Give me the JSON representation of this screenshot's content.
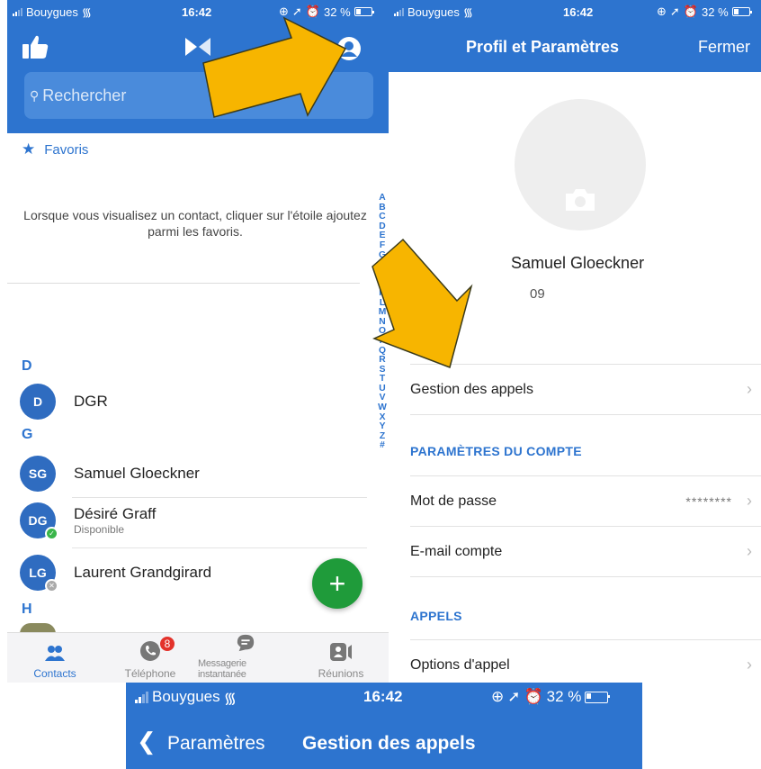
{
  "status_left": {
    "carrier": "Bouygues",
    "time": "16:42",
    "battery": "32 %"
  },
  "status_right": {
    "carrier": "Bouygues",
    "time": "16:42",
    "battery": "32 %"
  },
  "status_bottom": {
    "carrier": "Bouygues",
    "time": "16:42",
    "battery": "32 %"
  },
  "left": {
    "search_placeholder": "Rechercher",
    "favorites_label": "Favoris",
    "favorites_hint": "Lorsque vous visualisez un contact, cliquer sur l'étoile ajoutez parmi les favoris.",
    "index": [
      "A",
      "B",
      "C",
      "D",
      "E",
      "F",
      "G",
      "H",
      "I",
      "J",
      "K",
      "L",
      "M",
      "N",
      "O",
      "P",
      "Q",
      "R",
      "S",
      "T",
      "U",
      "V",
      "W",
      "X",
      "Y",
      "Z",
      "#"
    ],
    "sections": {
      "d": "D",
      "g": "G",
      "h": "H"
    },
    "contacts": [
      {
        "initials": "D",
        "name": "DGR",
        "status": ""
      },
      {
        "initials": "SG",
        "name": "Samuel Gloeckner",
        "status": ""
      },
      {
        "initials": "DG",
        "name": "Désiré Graff",
        "status": "Disponible"
      },
      {
        "initials": "LG",
        "name": "Laurent Grandgirard",
        "status": ""
      }
    ],
    "fab_label": "+",
    "tabs": [
      {
        "label": "Contacts",
        "icon": "contacts-icon"
      },
      {
        "label": "Téléphone",
        "icon": "phone-icon",
        "badge": "8"
      },
      {
        "label": "Messagerie instantanée",
        "icon": "chat-icon"
      },
      {
        "label": "Réunions",
        "icon": "meeting-icon"
      }
    ]
  },
  "right": {
    "title": "Profil et Paramètres",
    "close": "Fermer",
    "profile_name": "Samuel Gloeckner",
    "profile_phone": "09",
    "rows": {
      "call_management": "Gestion des appels",
      "account_section": "PARAMÈTRES DU COMPTE",
      "password": "Mot de passe",
      "password_value": "********",
      "account_email": "E-mail compte",
      "calls_section": "APPELS",
      "call_options": "Options d'appel"
    }
  },
  "bottom": {
    "back_label": "Paramètres",
    "title": "Gestion des appels"
  },
  "colors": {
    "brand_blue": "#2d74cf",
    "arrow_fill": "#f7b500",
    "fab_green": "#1f9b3a",
    "badge_red": "#e3322b"
  }
}
